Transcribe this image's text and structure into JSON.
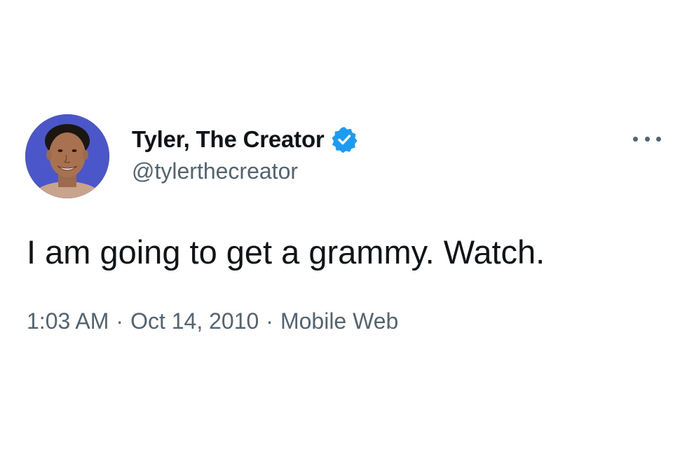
{
  "tweet": {
    "display_name": "Tyler, The Creator",
    "handle": "@tylerthecreator",
    "text": "I am going to get a grammy. Watch.",
    "time": "1:03 AM",
    "separator": "·",
    "date": "Oct 14, 2010",
    "source": "Mobile Web"
  },
  "icons": {
    "verified": "verified-badge-icon",
    "more": "more-options-icon"
  },
  "colors": {
    "verified_blue": "#1d9bf0",
    "secondary_text": "#536471",
    "primary_text": "#0f1419",
    "avatar_background": "#4b57c9"
  }
}
